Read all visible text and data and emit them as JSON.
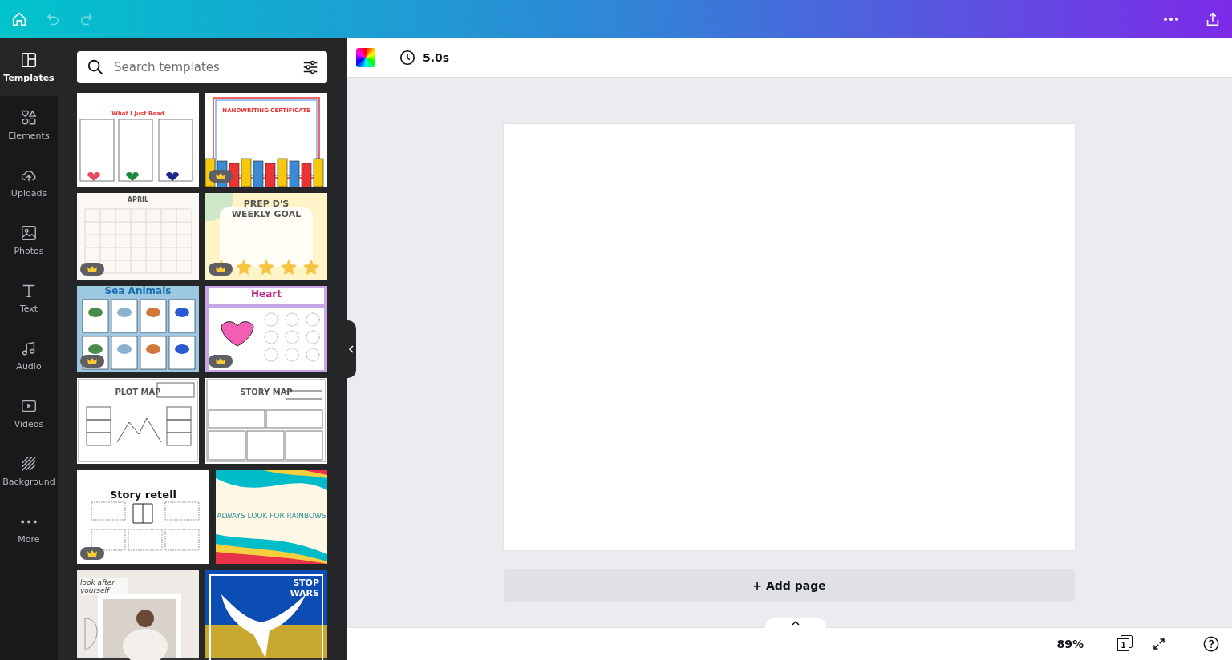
{
  "toolbar": {
    "duration": "5.0s"
  },
  "nav": [
    {
      "label": "Templates",
      "selected": true
    },
    {
      "label": "Elements",
      "selected": false
    },
    {
      "label": "Uploads",
      "selected": false
    },
    {
      "label": "Photos",
      "selected": false
    },
    {
      "label": "Text",
      "selected": false
    },
    {
      "label": "Audio",
      "selected": false
    },
    {
      "label": "Videos",
      "selected": false
    },
    {
      "label": "Background",
      "selected": false
    },
    {
      "label": "More",
      "selected": false
    }
  ],
  "search": {
    "placeholder": "Search templates"
  },
  "templates": [
    [
      {
        "kind": "reading",
        "title": "What I Just Read",
        "premium": false
      },
      {
        "kind": "certificate",
        "title": "HANDWRITING CERTIFICATE",
        "premium": true
      }
    ],
    [
      {
        "kind": "calendar",
        "title": "APRIL",
        "premium": true
      },
      {
        "kind": "goal",
        "title": "PREP D'S WEEKLY GOAL",
        "premium": true
      }
    ],
    [
      {
        "kind": "sea",
        "title": "Sea Animals",
        "premium": true
      },
      {
        "kind": "heart",
        "title": "Heart",
        "premium": true
      }
    ],
    [
      {
        "kind": "plot",
        "title": "PLOT MAP",
        "premium": false
      },
      {
        "kind": "story",
        "title": "STORY MAP",
        "premium": false
      }
    ],
    [
      {
        "kind": "retell",
        "title": "Story retell",
        "premium": true
      },
      {
        "kind": "rainbow",
        "title": "ALWAYS LOOK FOR RAINBOWS",
        "premium": false
      }
    ],
    [
      {
        "title": "look after yourself",
        "premium": false
      },
      {
        "kind": "dove",
        "title": "STOP WARS",
        "premium": false
      }
    ]
  ],
  "canvas": {
    "add_page": "+ Add page"
  },
  "status_bar": {
    "zoom": "89%",
    "page": "1"
  }
}
